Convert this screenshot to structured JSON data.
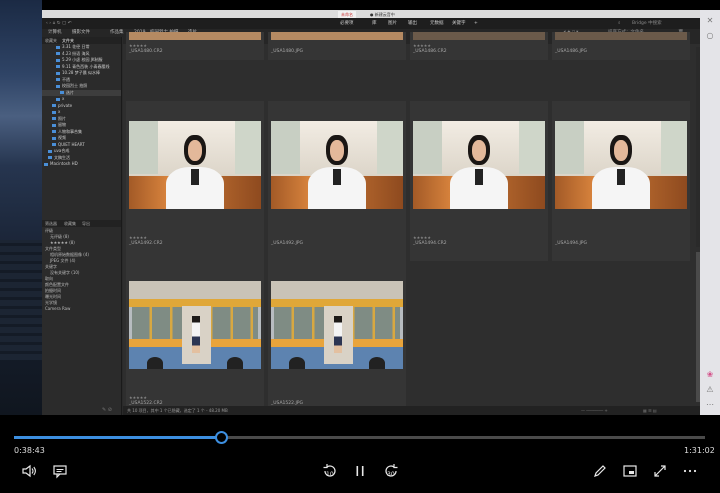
{
  "titlebar": {
    "tab_active": "未命名",
    "tab_other": "● 新建云音中"
  },
  "menubar": {
    "tabs": [
      "必要项",
      "库",
      "图片",
      "输出",
      "元数据",
      "关键字",
      "+"
    ],
    "search_placeholder": "Bridge 中搜索",
    "workspace": "排序方式：文件名"
  },
  "breadcrumb": [
    "计算机",
    "摄影文件",
    "作品集",
    "2019",
    "校园烈士 拍摄",
    "选片"
  ],
  "left_panel": {
    "tabs": [
      "收藏夹",
      "文件夹"
    ],
    "folders": [
      {
        "label": "3.31 花径 日常",
        "indent": 3
      },
      {
        "label": "4.23 纷语 海风",
        "indent": 3
      },
      {
        "label": "5.29 小虚 校园 JK制服",
        "indent": 3
      },
      {
        "label": "9.11 青色西装 小青春腰线",
        "indent": 3
      },
      {
        "label": "10.28 梦子晨 似水棒",
        "indent": 3
      },
      {
        "label": "不透",
        "indent": 3
      },
      {
        "label": "校园烈士 拍照",
        "indent": 3
      },
      {
        "label": "选片",
        "indent": 4,
        "selected": true
      },
      {
        "label": "x",
        "indent": 3
      },
      {
        "label": "private",
        "indent": 2
      },
      {
        "label": "x",
        "indent": 2
      },
      {
        "label": "照片",
        "indent": 2
      },
      {
        "label": "留物",
        "indent": 2
      },
      {
        "label": "人物和事合集",
        "indent": 2
      },
      {
        "label": "视频",
        "indent": 2
      },
      {
        "label": "QUIET HEART",
        "indent": 2
      },
      {
        "label": "uva合成",
        "indent": 1
      },
      {
        "label": "文稿生活",
        "indent": 1
      },
      {
        "label": "Macintosh HD",
        "indent": 0
      }
    ],
    "filter_tabs": [
      "筛选器",
      "收藏集",
      "导出"
    ],
    "filters": [
      "评级",
      "无评级 (8)",
      "★★★★★ (8)",
      "文件类型",
      "相机原始数据图像 (4)",
      "JPEG 文件 (4)",
      "关键字",
      "没有关键字 (10)",
      "取向",
      "颜色配置文件",
      "拍摄时间",
      "曝光时间",
      "光学镜",
      "Camera Raw"
    ]
  },
  "content": {
    "title": "内容",
    "rows": [
      {
        "files": [
          "_USA1480.CR2",
          "_USA1480.JPG",
          "_USA1486.CR2",
          "_USA1486.JPG"
        ],
        "stars": [
          "★★★★★",
          "",
          "★★★★★",
          ""
        ]
      },
      {
        "files": [
          "_USA1492.CR2",
          "_USA1492.JPG",
          "_USA1494.CR2",
          "_USA1494.JPG"
        ],
        "stars": [
          "★★★★★",
          "",
          "★★★★★",
          ""
        ]
      },
      {
        "files": [
          "_USA1522.CR2",
          "_USA1522.JPG"
        ],
        "stars": [
          "★★★★★",
          ""
        ]
      }
    ],
    "status": "共 10 项目，其中 1 个已隐藏，选定了 1 个 - 48.20 MB"
  },
  "player": {
    "elapsed": "0:38:43",
    "total": "1:31:02",
    "progress": 0.3,
    "skip_back": "10",
    "skip_fwd": "30"
  }
}
